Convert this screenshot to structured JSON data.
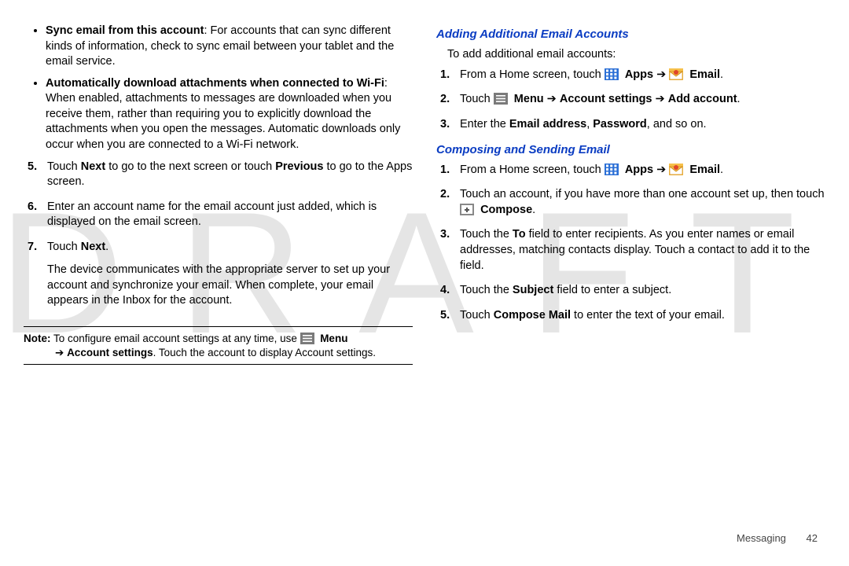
{
  "watermark": "DRAFT",
  "left": {
    "bullets": [
      {
        "lead": "Sync email from this account",
        "rest": ": For accounts that can sync different kinds of information, check to sync email between your tablet and the email service."
      },
      {
        "lead": "Automatically download attachments when connected to Wi-Fi",
        "rest": ": When enabled, attachments to messages are downloaded when you receive them, rather than requiring you to explicitly download the attachments when you open the messages. Automatic downloads only occur when you are connected to a Wi-Fi network."
      }
    ],
    "steps": [
      {
        "n": "5.",
        "pre": "Touch ",
        "b1": "Next",
        "mid": " to go to the next screen or touch ",
        "b2": "Previous",
        "post": " to go to the Apps screen."
      },
      {
        "n": "6.",
        "text": "Enter an account name for the email account just added, which is displayed on the email screen."
      },
      {
        "n": "7.",
        "pre": "Touch ",
        "b1": "Next",
        "post": ".",
        "para2": "The device communicates with the appropriate server to set up your account and synchronize your email. When complete, your email appears in the Inbox for the account."
      }
    ],
    "note": {
      "lead": "Note:",
      "line1": " To configure email account settings at any time, use ",
      "menu": "Menu",
      "line2_pre": "➔ ",
      "acct": "Account settings",
      "line2_post": ". Touch the account to display Account settings."
    }
  },
  "right": {
    "sec1": {
      "title": "Adding Additional Email Accounts",
      "intro": "To add additional email accounts:",
      "steps": [
        {
          "n": "1.",
          "pre": "From a Home screen, touch ",
          "apps": "Apps",
          "arrow": " ➔ ",
          "email": "Email",
          "post": "."
        },
        {
          "n": "2.",
          "pre": "Touch ",
          "menu": "Menu",
          "arrow1": " ➔ ",
          "acct": "Account settings",
          "arrow2": " ➔ ",
          "add": "Add account",
          "post": "."
        },
        {
          "n": "3.",
          "pre": "Enter the ",
          "b1": "Email address",
          "mid": ", ",
          "b2": "Password",
          "post": ", and so on."
        }
      ]
    },
    "sec2": {
      "title": "Composing and Sending Email",
      "steps": [
        {
          "n": "1.",
          "pre": "From a Home screen, touch ",
          "apps": "Apps",
          "arrow": " ➔ ",
          "email": "Email",
          "post": "."
        },
        {
          "n": "2.",
          "pre": "Touch an account, if you have more than one account set up, then touch ",
          "compose": "Compose",
          "post": "."
        },
        {
          "n": "3.",
          "pre": "Touch the ",
          "b1": "To",
          "post": " field to enter recipients. As you enter names or email addresses, matching contacts display. Touch a contact to add it to the field."
        },
        {
          "n": "4.",
          "pre": "Touch the ",
          "b1": "Subject",
          "post": " field to enter a subject."
        },
        {
          "n": "5.",
          "pre": "Touch ",
          "b1": "Compose Mail",
          "post": " to enter the text of your email."
        }
      ]
    }
  },
  "footer": {
    "section": "Messaging",
    "page": "42"
  }
}
